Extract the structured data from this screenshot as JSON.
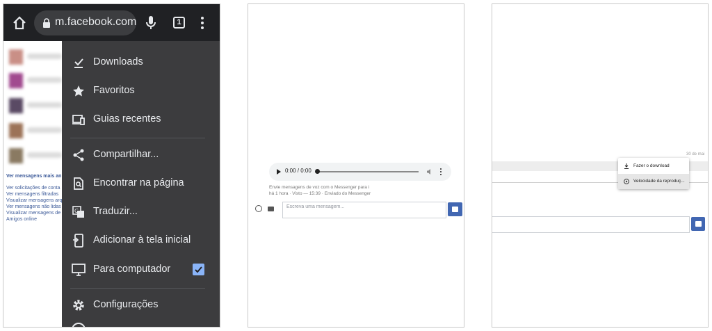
{
  "panel1": {
    "url": "m.facebook.com/",
    "tab_count": "1",
    "background_links": {
      "see_all": "Ver mensagens mais an",
      "links": [
        "Ver solicitações de conta",
        "Ver mensagens filtradas",
        "Visualizar mensagens arq",
        "Ver mensagens não lidas",
        "Visualizar mensagens de",
        "Amigos online"
      ]
    },
    "menu": {
      "items": [
        {
          "label": "Downloads",
          "icon": "download-icon"
        },
        {
          "label": "Favoritos",
          "icon": "star-icon"
        },
        {
          "label": "Guias recentes",
          "icon": "devices-icon"
        },
        {
          "label": "Compartilhar...",
          "icon": "share-icon"
        },
        {
          "label": "Encontrar na página",
          "icon": "find-icon"
        },
        {
          "label": "Traduzir...",
          "icon": "translate-icon"
        },
        {
          "label": "Adicionar à tela inicial",
          "icon": "add-home-icon"
        },
        {
          "label": "Para computador",
          "icon": "desktop-icon",
          "checked": true
        },
        {
          "label": "Configurações",
          "icon": "gear-icon"
        }
      ]
    }
  },
  "panel2": {
    "audio_time": "0:00 / 0:00",
    "note_line1": "Envie mensagens de voz com o Messenger para i",
    "note_line2": "há 1 hora · Visto — 15:39 · Enviado do Messenger",
    "input_placeholder": "Escreva uma mensagem..."
  },
  "panel3": {
    "date": "30 de mai",
    "context_menu": [
      {
        "label": "Fazer o download",
        "icon": "download-icon"
      },
      {
        "label": "Velocidade da reproduç...",
        "icon": "speed-icon"
      }
    ]
  },
  "colors": {
    "chrome_dark": "#202124",
    "menu_bg": "#3c3c3e",
    "facebook_blue": "#4267b2",
    "checkbox": "#8ab4f8"
  }
}
